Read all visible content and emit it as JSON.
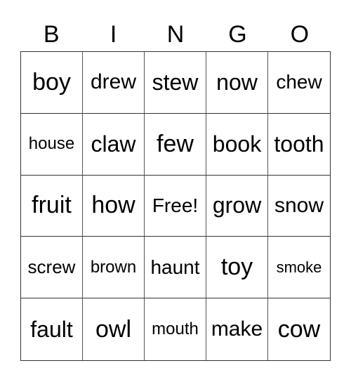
{
  "header": {
    "letters": [
      "B",
      "I",
      "N",
      "G",
      "O"
    ]
  },
  "card": {
    "rows": [
      [
        "boy",
        "drew",
        "stew",
        "now",
        "chew"
      ],
      [
        "house",
        "claw",
        "few",
        "book",
        "tooth"
      ],
      [
        "fruit",
        "how",
        "Free!",
        "grow",
        "snow"
      ],
      [
        "screw",
        "brown",
        "haunt",
        "toy",
        "smoke"
      ],
      [
        "fault",
        "owl",
        "mouth",
        "make",
        "cow"
      ]
    ],
    "free_space": "Free!"
  }
}
